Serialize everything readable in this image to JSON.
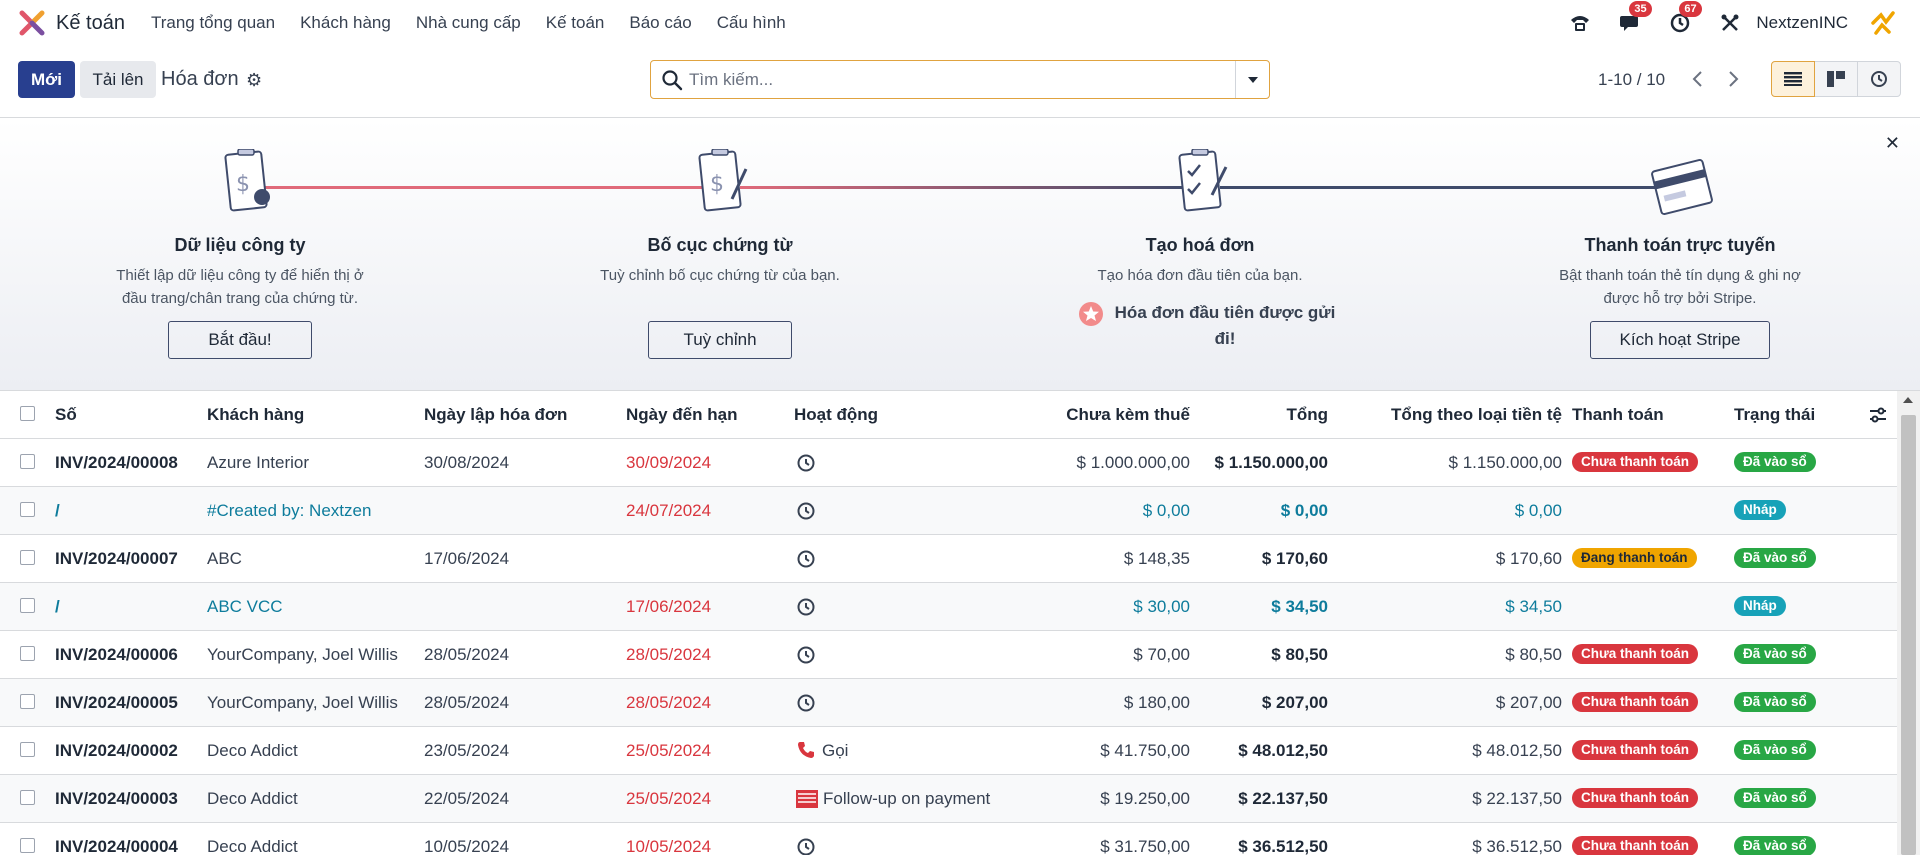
{
  "topnav": {
    "app_name": "Kế toán",
    "menu": [
      "Trang tổng quan",
      "Khách hàng",
      "Nhà cung cấp",
      "Kế toán",
      "Báo cáo",
      "Cấu hình"
    ],
    "messages_count": "35",
    "activities_count": "67",
    "company": "NextzenINC"
  },
  "control": {
    "new_label": "Mới",
    "upload_label": "Tải lên",
    "breadcrumb": "Hóa đơn",
    "search_placeholder": "Tìm kiếm...",
    "pager": "1-10 / 10"
  },
  "banner": {
    "steps": [
      {
        "title": "Dữ liệu công ty",
        "desc1": "Thiết lập dữ liệu công ty để hiển thị ở",
        "desc2": "đầu trang/chân trang của chứng từ.",
        "button": "Bắt đầu!"
      },
      {
        "title": "Bố cục chứng từ",
        "desc1": "Tuỳ chỉnh bố cục chứng từ của bạn.",
        "desc2": "",
        "button": "Tuỳ chỉnh"
      },
      {
        "title": "Tạo hoá đơn",
        "desc1": "Tạo hóa đơn đầu tiên của bạn.",
        "desc2": "",
        "done1": "Hóa đơn đầu tiên được gửi",
        "done2": "đi!"
      },
      {
        "title": "Thanh toán trực tuyến",
        "desc1": "Bật thanh toán thẻ tín dụng & ghi nợ",
        "desc2": "được hỗ trợ bởi Stripe.",
        "button": "Kích hoạt Stripe"
      }
    ]
  },
  "table": {
    "headers": {
      "number": "Số",
      "partner": "Khách hàng",
      "invoice_date": "Ngày lập hóa đơn",
      "due_date": "Ngày đến hạn",
      "activity": "Hoạt động",
      "untaxed": "Chưa kèm thuế",
      "total": "Tổng",
      "total_currency": "Tổng theo loại tiền tệ",
      "payment": "Thanh toán",
      "status": "Trạng thái"
    },
    "rows": [
      {
        "number": "INV/2024/00008",
        "partner": "Azure Interior",
        "invoice_date": "30/08/2024",
        "due_date": "30/09/2024",
        "activity": "",
        "untaxed": "$ 1.000.000,00",
        "total": "$ 1.150.000,00",
        "total_currency": "$ 1.150.000,00",
        "payment": "Chưa thanh toán",
        "status": "Đã vào sổ"
      },
      {
        "number": "/",
        "partner": "#Created by: Nextzen",
        "invoice_date": "",
        "due_date": "24/07/2024",
        "activity": "",
        "untaxed": "$ 0,00",
        "total": "$ 0,00",
        "total_currency": "$ 0,00",
        "payment": "",
        "status": "Nháp"
      },
      {
        "number": "INV/2024/00007",
        "partner": "ABC",
        "invoice_date": "17/06/2024",
        "due_date": "",
        "activity": "",
        "untaxed": "$ 148,35",
        "total": "$ 170,60",
        "total_currency": "$ 170,60",
        "payment": "Đang thanh toán",
        "status": "Đã vào sổ"
      },
      {
        "number": "/",
        "partner": "ABC VCC",
        "invoice_date": "",
        "due_date": "17/06/2024",
        "activity": "",
        "untaxed": "$ 30,00",
        "total": "$ 34,50",
        "total_currency": "$ 34,50",
        "payment": "",
        "status": "Nháp"
      },
      {
        "number": "INV/2024/00006",
        "partner": "YourCompany, Joel Willis",
        "invoice_date": "28/05/2024",
        "due_date": "28/05/2024",
        "activity": "",
        "untaxed": "$ 70,00",
        "total": "$ 80,50",
        "total_currency": "$ 80,50",
        "payment": "Chưa thanh toán",
        "status": "Đã vào sổ"
      },
      {
        "number": "INV/2024/00005",
        "partner": "YourCompany, Joel Willis",
        "invoice_date": "28/05/2024",
        "due_date": "28/05/2024",
        "activity": "",
        "untaxed": "$ 180,00",
        "total": "$ 207,00",
        "total_currency": "$ 207,00",
        "payment": "Chưa thanh toán",
        "status": "Đã vào sổ"
      },
      {
        "number": "INV/2024/00002",
        "partner": "Deco Addict",
        "invoice_date": "23/05/2024",
        "due_date": "25/05/2024",
        "activity": "Gọi",
        "untaxed": "$ 41.750,00",
        "total": "$ 48.012,50",
        "total_currency": "$ 48.012,50",
        "payment": "Chưa thanh toán",
        "status": "Đã vào sổ"
      },
      {
        "number": "INV/2024/00003",
        "partner": "Deco Addict",
        "invoice_date": "22/05/2024",
        "due_date": "25/05/2024",
        "activity": "Follow-up on payment",
        "untaxed": "$ 19.250,00",
        "total": "$ 22.137,50",
        "total_currency": "$ 22.137,50",
        "payment": "Chưa thanh toán",
        "status": "Đã vào sổ"
      },
      {
        "number": "INV/2024/00004",
        "partner": "Deco Addict",
        "invoice_date": "10/05/2024",
        "due_date": "10/05/2024",
        "activity": "",
        "untaxed": "$ 31.750,00",
        "total": "$ 36.512,50",
        "total_currency": "$ 36.512,50",
        "payment": "Chưa thanh toán",
        "status": "Đã vào sổ"
      }
    ]
  },
  "colors": {
    "primary": "#283f8f",
    "accent": "#e0a340",
    "danger": "#d9363e",
    "success": "#28a745",
    "info": "#17a2b8",
    "warning": "#f0a500",
    "draft_link": "#0e7c9c"
  }
}
